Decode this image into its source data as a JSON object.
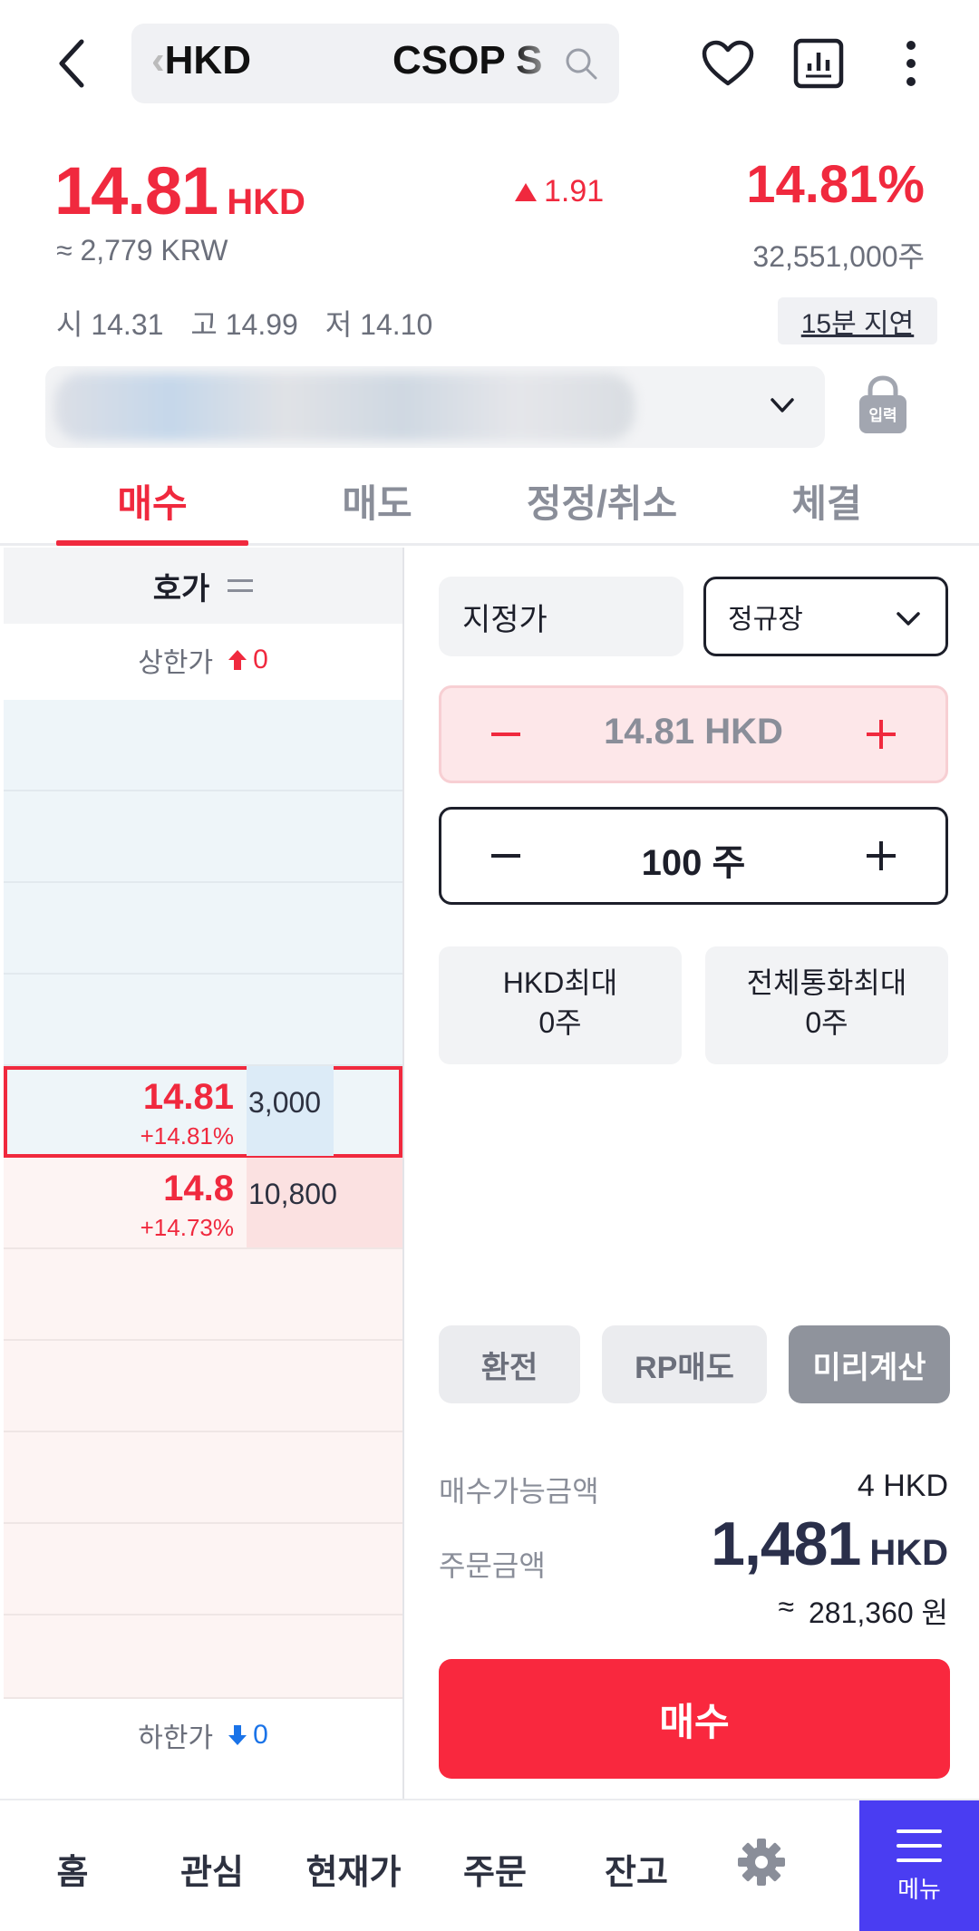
{
  "header": {
    "search_text_prefix": "‹",
    "search_text_currency": "HKD",
    "search_text_name": "CSOP S"
  },
  "quote": {
    "price": "14.81",
    "currency": "HKD",
    "change": "1.91",
    "change_pct": "14.81%",
    "krw_approx": "≈ 2,779 KRW",
    "volume": "32,551,000주",
    "open": "시 14.31",
    "high": "고 14.99",
    "low": "저 14.10",
    "delay_label": "15분 지연"
  },
  "account": {
    "lock_label": "입력"
  },
  "tabs": [
    {
      "label": "매수",
      "active": true
    },
    {
      "label": "매도",
      "active": false
    },
    {
      "label": "정정/취소",
      "active": false
    },
    {
      "label": "체결",
      "active": false
    }
  ],
  "orderbook": {
    "header": "호가",
    "upper_limit_label": "상한가",
    "upper_limit_value": "0",
    "lower_limit_label": "하한가",
    "lower_limit_value": "0",
    "current_price": "14.81",
    "current_rate": "+14.81%",
    "current_qty": "3,000",
    "bid_price": "14.8",
    "bid_rate": "+14.73%",
    "bid_qty": "10,800"
  },
  "order_form": {
    "order_type": "지정가",
    "session": "정규장",
    "price": "14.81 HKD",
    "quantity": "100 주",
    "hkd_max_label": "HKD최대",
    "hkd_max_value": "0주",
    "all_max_label": "전체통화최대",
    "all_max_value": "0주",
    "exchange_button": "환전",
    "rp_sell_button": "RP매도",
    "precalc_button": "미리계산",
    "available_label": "매수가능금액",
    "available_value": "4 HKD",
    "order_amount_label": "주문금액",
    "order_amount": "1,481",
    "order_amount_currency": "HKD",
    "order_amount_krw_prefix": "≈",
    "order_amount_krw": "281,360 원",
    "buy_button": "매수"
  },
  "bottom_nav": {
    "home": "홈",
    "watch": "관심",
    "current_price": "현재가",
    "order": "주문",
    "balance": "잔고",
    "menu": "메뉴"
  },
  "colors": {
    "accent_red": "#f0293e",
    "accent_blue": "#1a73e8",
    "menu_purple": "#4a3df2"
  }
}
